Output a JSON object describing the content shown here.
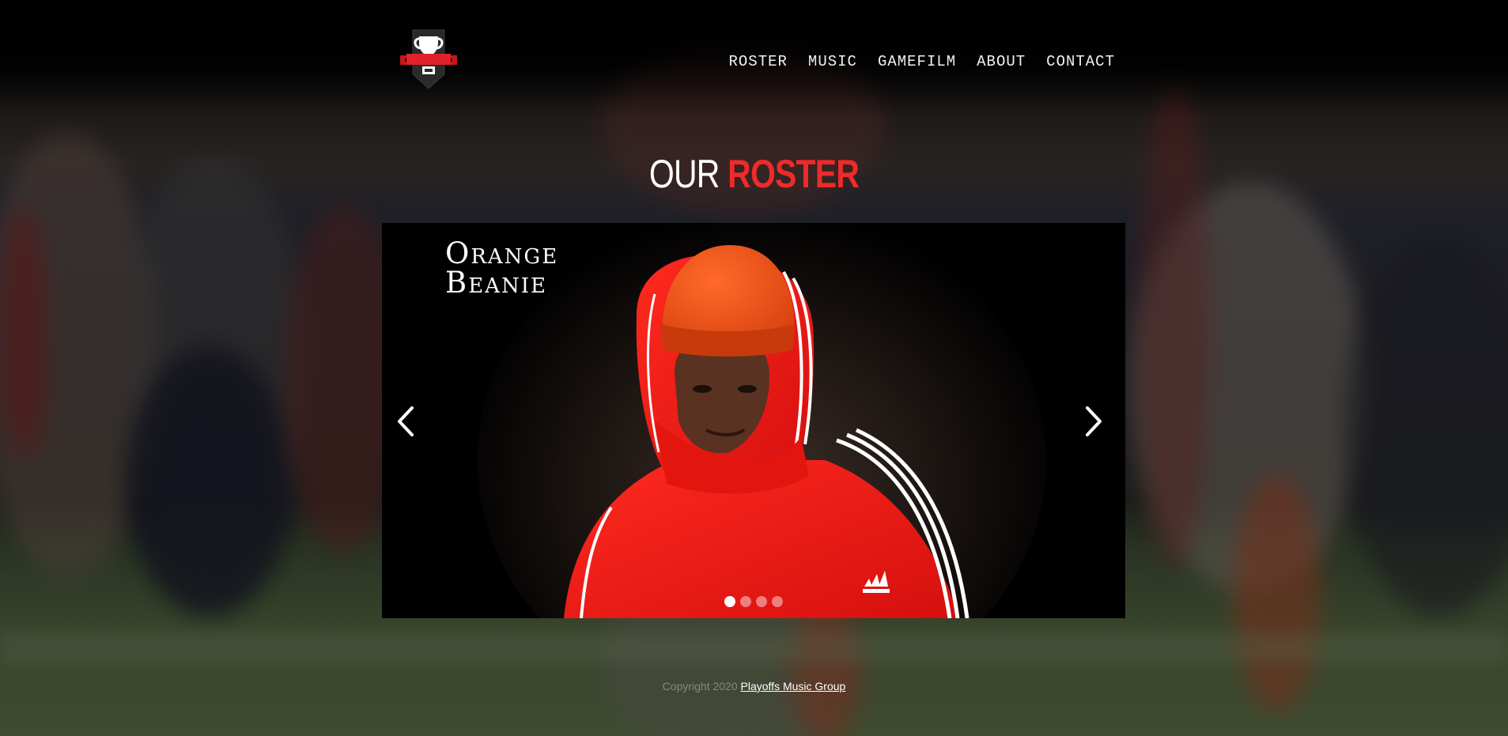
{
  "nav": {
    "items": [
      {
        "label": "ROSTER"
      },
      {
        "label": "MUSIC"
      },
      {
        "label": "GAMEFILM"
      },
      {
        "label": "ABOUT"
      },
      {
        "label": "CONTACT"
      }
    ]
  },
  "hero": {
    "title_white": "OUR",
    "title_red": "ROSTER"
  },
  "slider": {
    "caption_line1": "Orange",
    "caption_line2": "Beanie",
    "slide_count": 4,
    "active_slide": 1
  },
  "footer": {
    "copyright": "Copyright 2020",
    "link_text": "Playoffs Music Group"
  },
  "colors": {
    "accent_red": "#ee2a2a",
    "nav_text": "#f2f2f2"
  },
  "icons": {
    "logo": "trophy-shield-logo",
    "prev": "chevron-left-icon",
    "next": "chevron-right-icon"
  }
}
